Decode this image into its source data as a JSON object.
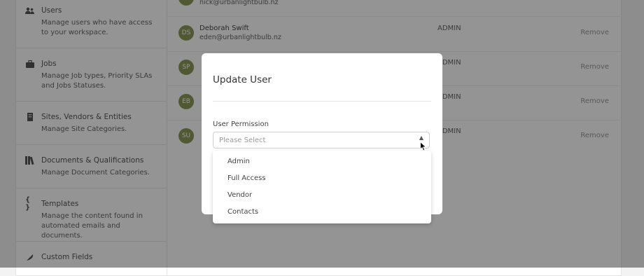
{
  "sidebar": {
    "items": [
      {
        "label": "Users",
        "desc": "Manage users who have access to your workspace.",
        "icon": "users-icon"
      },
      {
        "label": "Jobs",
        "desc": "Manage Job types, Priority SLAs and Jobs Statuses.",
        "icon": "briefcase-icon"
      },
      {
        "label": "Sites, Vendors & Entities",
        "desc": "Manage Site Categories.",
        "icon": "building-icon"
      },
      {
        "label": "Documents & Qualifications",
        "desc": "Manage Document Categories.",
        "icon": "books-icon"
      },
      {
        "label": "Templates",
        "desc": "Manage the content found in automated emails and documents.",
        "icon": "braces-icon"
      },
      {
        "label": "Custom Fields",
        "desc": "",
        "icon": "feather-icon"
      }
    ]
  },
  "users": [
    {
      "initials": "",
      "name": "",
      "email": "nick@urbanlightbulb.nz",
      "role": "",
      "action": ""
    },
    {
      "initials": "DS",
      "name": "Deborah Swift",
      "email": "eden@urbanlightbulb.nz",
      "role": "ADMIN",
      "action": "Remove"
    },
    {
      "initials": "SP",
      "name": "",
      "email": "",
      "role": "ADMIN",
      "action": "Remove"
    },
    {
      "initials": "EB",
      "name": "",
      "email": "",
      "role": "ADMIN",
      "action": "Remove"
    },
    {
      "initials": "SU",
      "name": "",
      "email": "",
      "role": "ADMIN",
      "action": "Remove"
    }
  ],
  "modal": {
    "title": "Update User",
    "field_label": "User Permission",
    "select": {
      "placeholder": "Please Select"
    },
    "options": [
      "Admin",
      "Full Access",
      "Vendor",
      "Contacts"
    ]
  },
  "colors": {
    "avatar": "#8b9a55",
    "overlay": "rgba(0,0,0,0.42)"
  }
}
